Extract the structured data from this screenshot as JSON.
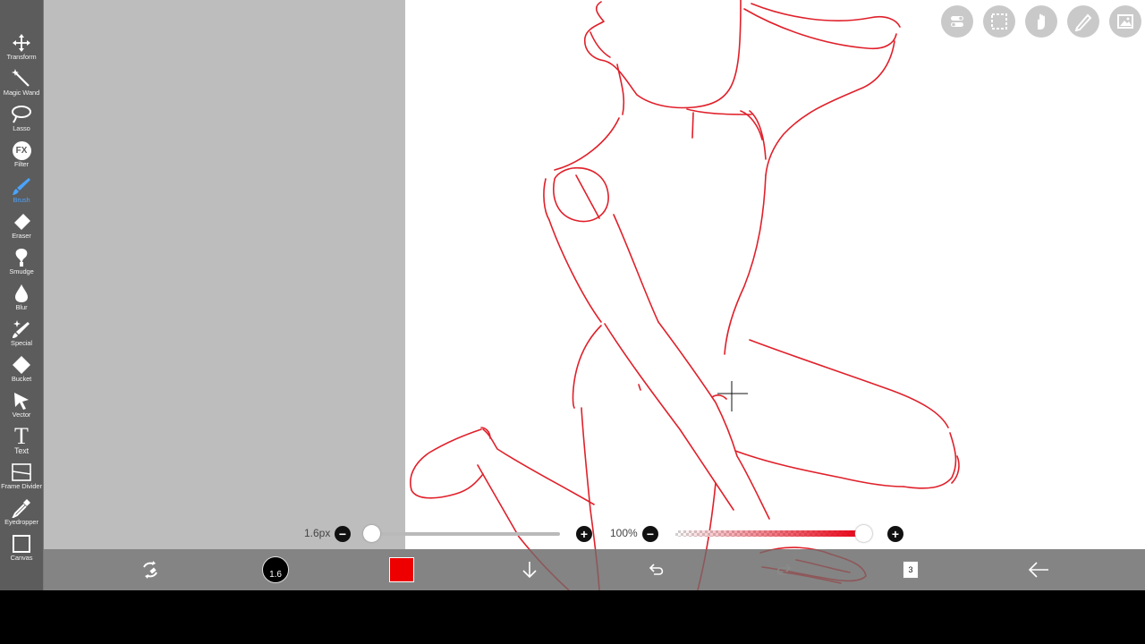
{
  "toolbar": {
    "tools": [
      {
        "label": "Transform",
        "icon": "move-icon"
      },
      {
        "label": "Magic Wand",
        "icon": "magic-wand-icon"
      },
      {
        "label": "Lasso",
        "icon": "lasso-icon"
      },
      {
        "label": "Filter",
        "icon": "fx-icon",
        "glyph": "FX"
      },
      {
        "label": "Brush",
        "icon": "brush-icon",
        "active": true
      },
      {
        "label": "Eraser",
        "icon": "eraser-icon"
      },
      {
        "label": "Smudge",
        "icon": "smudge-icon"
      },
      {
        "label": "Blur",
        "icon": "blur-drop-icon"
      },
      {
        "label": "Special",
        "icon": "special-brush-icon"
      },
      {
        "label": "Bucket",
        "icon": "bucket-icon"
      },
      {
        "label": "Vector",
        "icon": "vector-arrow-icon"
      },
      {
        "label": "Text",
        "icon": "text-icon",
        "glyph": "T"
      },
      {
        "label": "Frame Divider",
        "icon": "frame-divider-icon"
      },
      {
        "label": "Eyedropper",
        "icon": "eyedropper-icon"
      },
      {
        "label": "Canvas",
        "icon": "canvas-icon"
      }
    ]
  },
  "top_right_buttons": [
    "toggle-menu-icon",
    "selection-icon",
    "hand-gesture-icon",
    "ruler-pen-icon",
    "image-gallery-icon"
  ],
  "brush_size": {
    "value_label": "1.6px",
    "indicator_label": "1.6",
    "level": 0.02
  },
  "opacity": {
    "value_label": "100%",
    "level": 1.0
  },
  "slider_buttons": {
    "minus": "−",
    "plus": "+"
  },
  "bottom_bar": {
    "items": [
      "swap-tools-icon",
      "brush-size-indicator",
      "color-swatch",
      "download-icon",
      "undo-icon",
      "redo-icon",
      "layers-icon",
      "back-arrow-icon"
    ],
    "layers_count": "3"
  },
  "colors": {
    "stroke": "#e0202a",
    "current_color": "#ee0000",
    "active_tool": "#4aa3ff",
    "toolbar_bg": "#5c5c5c",
    "canvas_bg": "#bdbdbd"
  }
}
